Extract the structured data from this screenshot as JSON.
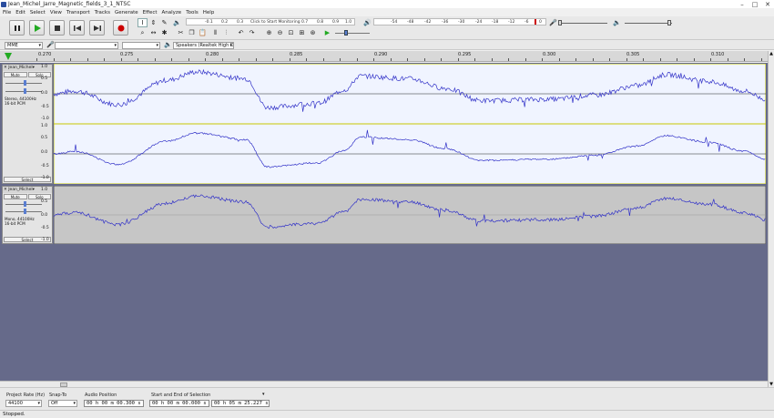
{
  "window": {
    "title": "Jean_Michel_Jarre_Magnetic_fields_3_1_NTSC"
  },
  "menu": [
    "File",
    "Edit",
    "Select",
    "View",
    "Transport",
    "Tracks",
    "Generate",
    "Effect",
    "Analyze",
    "Tools",
    "Help"
  ],
  "transport": {
    "pause": "pause",
    "play": "play",
    "stop": "stop",
    "skip_start": "skip-start",
    "skip_end": "skip-end",
    "record": "record"
  },
  "record_meter": {
    "hint": "Click to Start Monitoring",
    "ticks": [
      "-54",
      "-48",
      "-42",
      "-36",
      "-30",
      "-24",
      "-18",
      "-12",
      "-6",
      "0"
    ]
  },
  "playback_meter": {
    "ticks": [
      "-0.1",
      "0.2",
      "0.3",
      "0.7",
      "0.8",
      "0.9",
      "1.0"
    ]
  },
  "devices": {
    "host": "MME",
    "rec_device": "",
    "channels": "",
    "play_device": "Speakers (Realtek High D"
  },
  "ruler": {
    "start": "0.270",
    "labels": [
      "0.275",
      "0.280",
      "0.285",
      "0.290",
      "0.295",
      "0.300",
      "0.305",
      "0.310"
    ]
  },
  "tracks": [
    {
      "name": "Jean_Michel",
      "mute": "Mute",
      "solo": "Solo",
      "info1": "Stereo, 44100Hz",
      "info2": "16-bit PCM",
      "select": "Select",
      "axis": [
        "1.0",
        "0.5",
        "0.0",
        "-0.5",
        "-1.0"
      ]
    },
    {
      "name": "Jean_Michel",
      "mute": "Mute",
      "solo": "Solo",
      "info1": "Mono, 44100Hz",
      "info2": "16-bit PCM",
      "select": "Select",
      "axis": [
        "1.0",
        "0.5",
        "0.0",
        "-0.5",
        "-1.0"
      ]
    }
  ],
  "selection": {
    "rate_label": "Project Rate (Hz)",
    "rate_value": "44100",
    "snap_label": "Snap-To",
    "snap_value": "Off",
    "audio_pos_label": "Audio Position",
    "audio_pos_value": "00 h 00 m 00.300 s",
    "sel_label": "Start and End of Selection",
    "sel_start": "00 h 00 m 00.000 s",
    "sel_end": "00 h 05 m 25.227 s"
  },
  "status": "Stopped.",
  "colors": {
    "wave": "#3232c8",
    "track_bg": "#f0f4ff",
    "track_bg_unselected": "#c6c6c6",
    "record": "#cc0000",
    "play": "#22aa22"
  }
}
